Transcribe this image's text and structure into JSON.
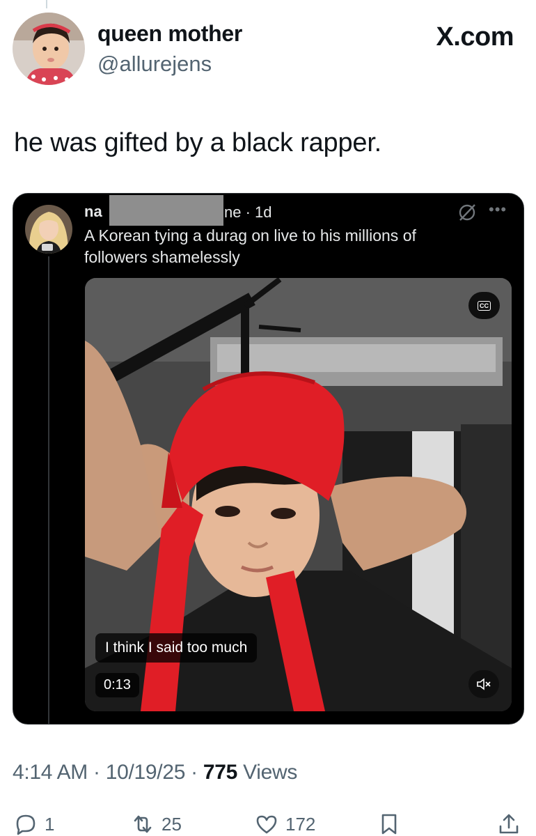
{
  "tweet": {
    "author_name": "queen mother",
    "author_handle": "@allurejens",
    "site_logo": "X.com",
    "text": "he was gifted by a black rapper."
  },
  "quoted": {
    "name_visible": "na",
    "meta": "ne · 1d",
    "text": "A Korean tying a durag on live to his millions of followers shamelessly",
    "video": {
      "cc_label": "CC",
      "caption": "I think I said too much",
      "duration": "0:13"
    }
  },
  "footer": {
    "time": "4:14 AM",
    "date": "10/19/25",
    "views_count": "775",
    "views_label": "Views",
    "separator": " · "
  },
  "actions": {
    "replies": "1",
    "reposts": "25",
    "likes": "172"
  },
  "colors": {
    "text_primary": "#0f1419",
    "text_secondary": "#536471",
    "embed_bg": "#000000",
    "durag_red": "#e01e26"
  },
  "icons": [
    "reply-icon",
    "repost-icon",
    "like-icon",
    "bookmark-icon",
    "share-icon",
    "grok-icon",
    "more-icon",
    "mute-icon",
    "captions-icon"
  ]
}
